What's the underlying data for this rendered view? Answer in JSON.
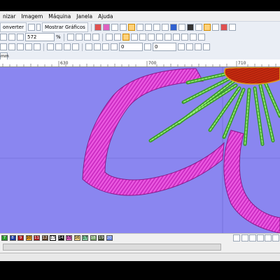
{
  "menu": {
    "items": [
      "nizar",
      "Imagem",
      "Máquina",
      "Janela",
      "Ajuda"
    ]
  },
  "toolbar1": {
    "converter_label": "onverter",
    "mostrar_label": "Mostrar Gráficos"
  },
  "toolbar2": {
    "zoom_value": "572",
    "percent": "%"
  },
  "toolbar3": {
    "field1": "0",
    "field2": "0"
  },
  "tabs": {
    "active": "mm"
  },
  "ruler": {
    "ticks": [
      "630",
      "700",
      "710"
    ]
  },
  "palette": {
    "swatches": [
      {
        "label": "7",
        "color": "#2a9a2a"
      },
      {
        "label": "8",
        "color": "#1a3aa0"
      },
      {
        "label": "9",
        "color": "#b01818"
      },
      {
        "label": "10",
        "color": "#e8a020"
      },
      {
        "label": "11",
        "color": "#a82020"
      },
      {
        "label": "12",
        "color": "#5a3a20"
      },
      {
        "label": "13",
        "color": "#ffffff"
      },
      {
        "label": "14",
        "color": "#111111"
      },
      {
        "label": "15",
        "color": "#e060c0"
      },
      {
        "label": "16",
        "color": "#f0d080"
      },
      {
        "label": "17",
        "color": "#80d0a0"
      },
      {
        "label": "18",
        "color": "#70a060"
      },
      {
        "label": "19",
        "color": "#405030"
      },
      {
        "label": "20",
        "color": "#6080e0"
      }
    ]
  },
  "colors": {
    "canvas": "#8a86f0",
    "petal": "#e040d0",
    "stitch_green": "#40c040",
    "center_red": "#c02010"
  }
}
